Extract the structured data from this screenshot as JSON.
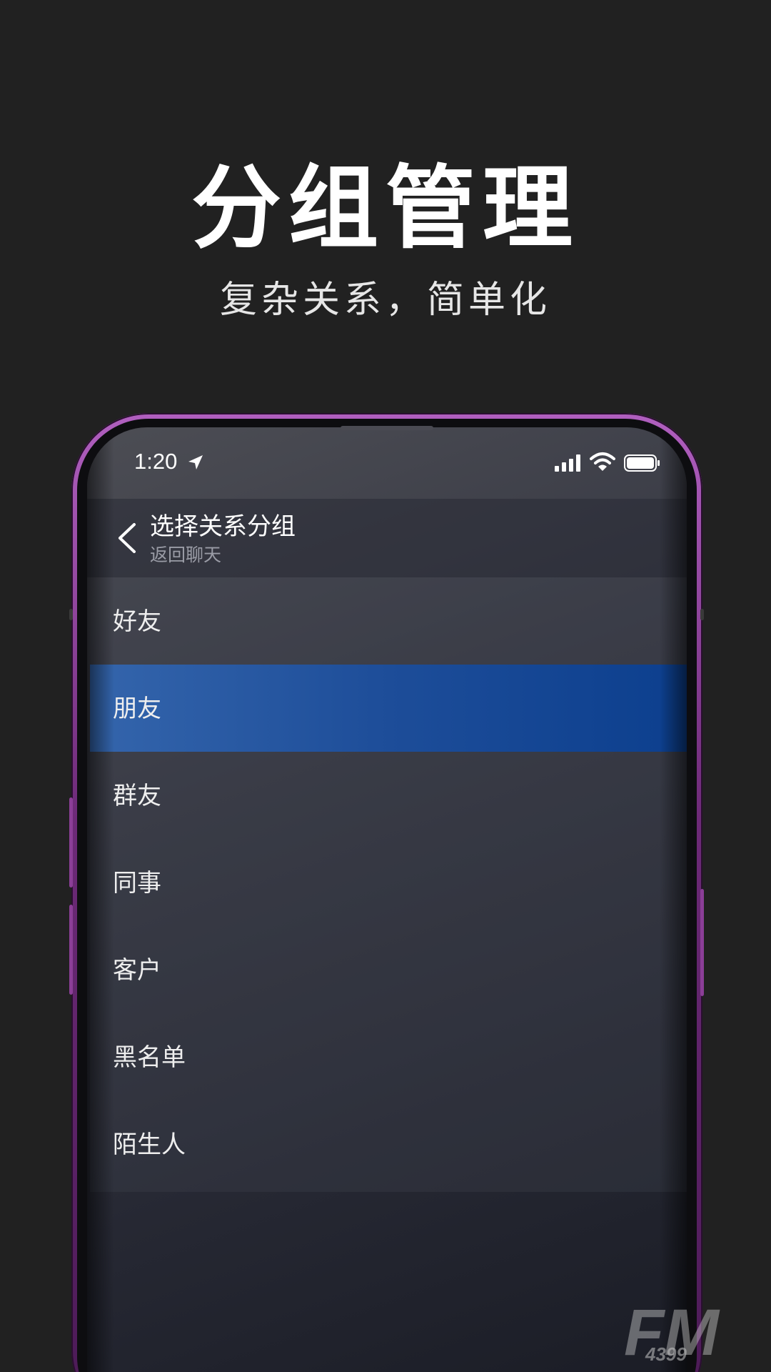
{
  "hero": {
    "title": "分组管理",
    "subtitle": "复杂关系，简单化"
  },
  "status_bar": {
    "time": "1:20",
    "icons": [
      "location-arrow-icon",
      "signal-icon",
      "wifi-icon",
      "battery-icon"
    ]
  },
  "nav": {
    "title": "选择关系分组",
    "subtitle": "返回聊天",
    "back_icon": "chevron-left-icon"
  },
  "groups": [
    {
      "label": "好友",
      "selected": false
    },
    {
      "label": "朋友",
      "selected": true
    },
    {
      "label": "群友",
      "selected": false
    },
    {
      "label": "同事",
      "selected": false
    },
    {
      "label": "客户",
      "selected": false
    },
    {
      "label": "黑名单",
      "selected": false
    },
    {
      "label": "陌生人",
      "selected": false
    }
  ],
  "watermark": {
    "logo": "FM",
    "sub": "4399"
  },
  "colors": {
    "background": "#212121",
    "selected_row": "#1d4d99",
    "phone_frame": "#8b3e97"
  }
}
